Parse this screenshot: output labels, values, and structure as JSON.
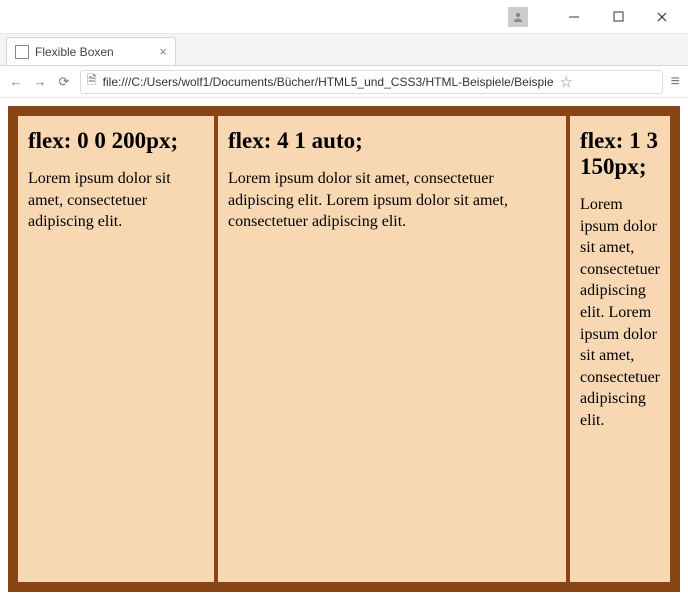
{
  "window": {
    "profile_icon": "user-icon"
  },
  "tab": {
    "title": "Flexible Boxen"
  },
  "addressbar": {
    "url": "file:///C:/Users/wolf1/Documents/Bücher/HTML5_und_CSS3/HTML-Beispiele/Beispie"
  },
  "boxes": [
    {
      "heading": "flex: 0 0 200px;",
      "body": "Lorem ipsum dolor sit amet, consectetuer adipiscing elit."
    },
    {
      "heading": "flex: 4 1 auto;",
      "body": "Lorem ipsum dolor sit amet, consectetuer adipiscing elit. Lorem ipsum dolor sit amet, consectetuer adipiscing elit."
    },
    {
      "heading": "flex: 1 3 150px;",
      "body": "Lorem ipsum dolor sit amet, consectetuer adipiscing elit. Lorem ipsum dolor sit amet, consectetuer adipiscing elit."
    }
  ]
}
